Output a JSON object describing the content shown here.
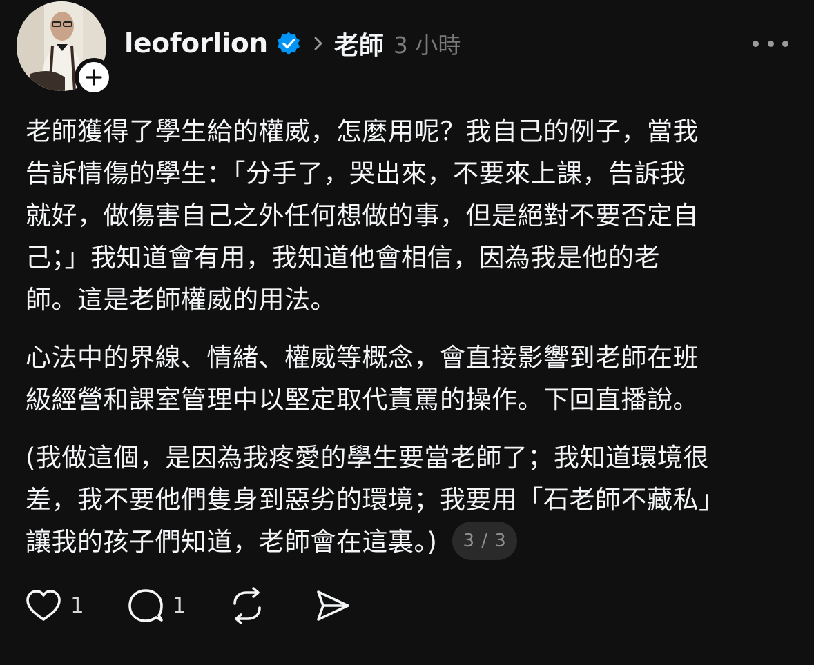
{
  "post": {
    "author": {
      "username": "leoforlion",
      "verified": true,
      "avatar_icon": "avatar-photo",
      "follow_icon": "plus-icon"
    },
    "topic": "老師",
    "timestamp": "3 小時",
    "more_icon": "more-horizontal-icon",
    "paragraphs": [
      {
        "lines": [
          "老師獲得了學生給的權威，怎麼用呢？我自己的例子，當我",
          "告訴情傷的學生：「分手了，哭出來，不要來上課，告訴我",
          "就好，做傷害自己之外任何想做的事，但是絕對不要否定自",
          "己；」我知道會有用，我知道他會相信，因為我是他的老",
          "師。這是老師權威的用法。"
        ]
      },
      {
        "lines": [
          "心法中的界線、情緒、權威等概念，會直接影響到老師在班",
          "級經營和課室管理中以堅定取代責罵的操作。下回直播說。"
        ]
      },
      {
        "lines": [
          "(我做這個，是因為我疼愛的學生要當老師了；我知道環境很",
          "差，我不要他們隻身到惡劣的環境；我要用「石老師不藏私」",
          "讓我的孩子們知道，老師會在這裏。)"
        ]
      }
    ],
    "page_indicator": "3 / 3",
    "actions": {
      "like_count": "1",
      "reply_count": "1"
    }
  },
  "colors": {
    "background": "#101010",
    "text": "#f3f5f7",
    "muted": "#7a7a7a",
    "verified_blue": "#0095f6"
  }
}
